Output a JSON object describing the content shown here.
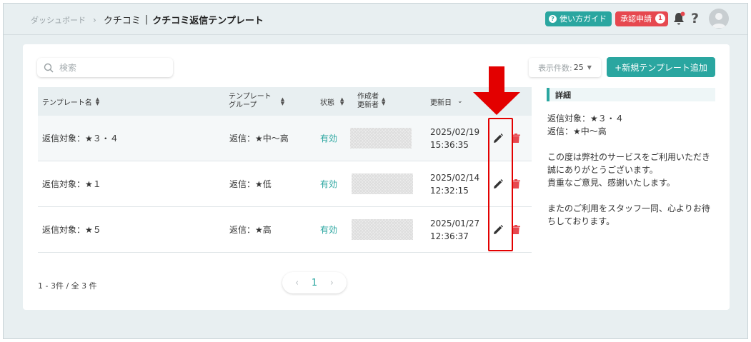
{
  "breadcrumb": {
    "dashboard": "ダッシュボード",
    "sep": "›",
    "section": "クチコミ",
    "bar": "|",
    "current": "クチコミ返信テンプレート"
  },
  "header": {
    "guide_label": "使い方ガイド",
    "approval_label": "承認申請",
    "approval_count": "1",
    "help": "?"
  },
  "toolbar": {
    "search_placeholder": "検索",
    "per_page_label": "表示件数:",
    "per_page_value": "25",
    "add_label": "+新規テンプレート追加"
  },
  "table": {
    "headers": {
      "name": "テンプレート名",
      "group_line1": "テンプレート",
      "group_line2": "グループ",
      "status": "状態",
      "author_line1": "作成者",
      "author_line2": "更新者",
      "updated": "更新日"
    },
    "rows": [
      {
        "name": "返信対象：★３・４",
        "group": "返信：★中〜高",
        "status": "有効",
        "date": "2025/02/19",
        "time": "15:36:35"
      },
      {
        "name": "返信対象：★１",
        "group": "返信：★低",
        "status": "有効",
        "date": "2025/02/14",
        "time": "12:32:15"
      },
      {
        "name": "返信対象：★５",
        "group": "返信：★高",
        "status": "有効",
        "date": "2025/01/27",
        "time": "12:36:37"
      }
    ]
  },
  "footer": {
    "count": "1 - 3件 / 全 3 件",
    "page": "1"
  },
  "detail": {
    "title": "詳細",
    "target": "返信対象：★３・４",
    "group": "返信：★中〜高",
    "body1": "この度は弊社のサービスをご利用いただき誠にありがとうございます。",
    "body2": "貴重なご意見、感謝いたします。",
    "body3": "またのご利用をスタッフ一同、心よりお待ちしております。"
  },
  "colors": {
    "accent": "#2aa6a0",
    "danger": "#e6484f",
    "annotation": "#e30000"
  }
}
